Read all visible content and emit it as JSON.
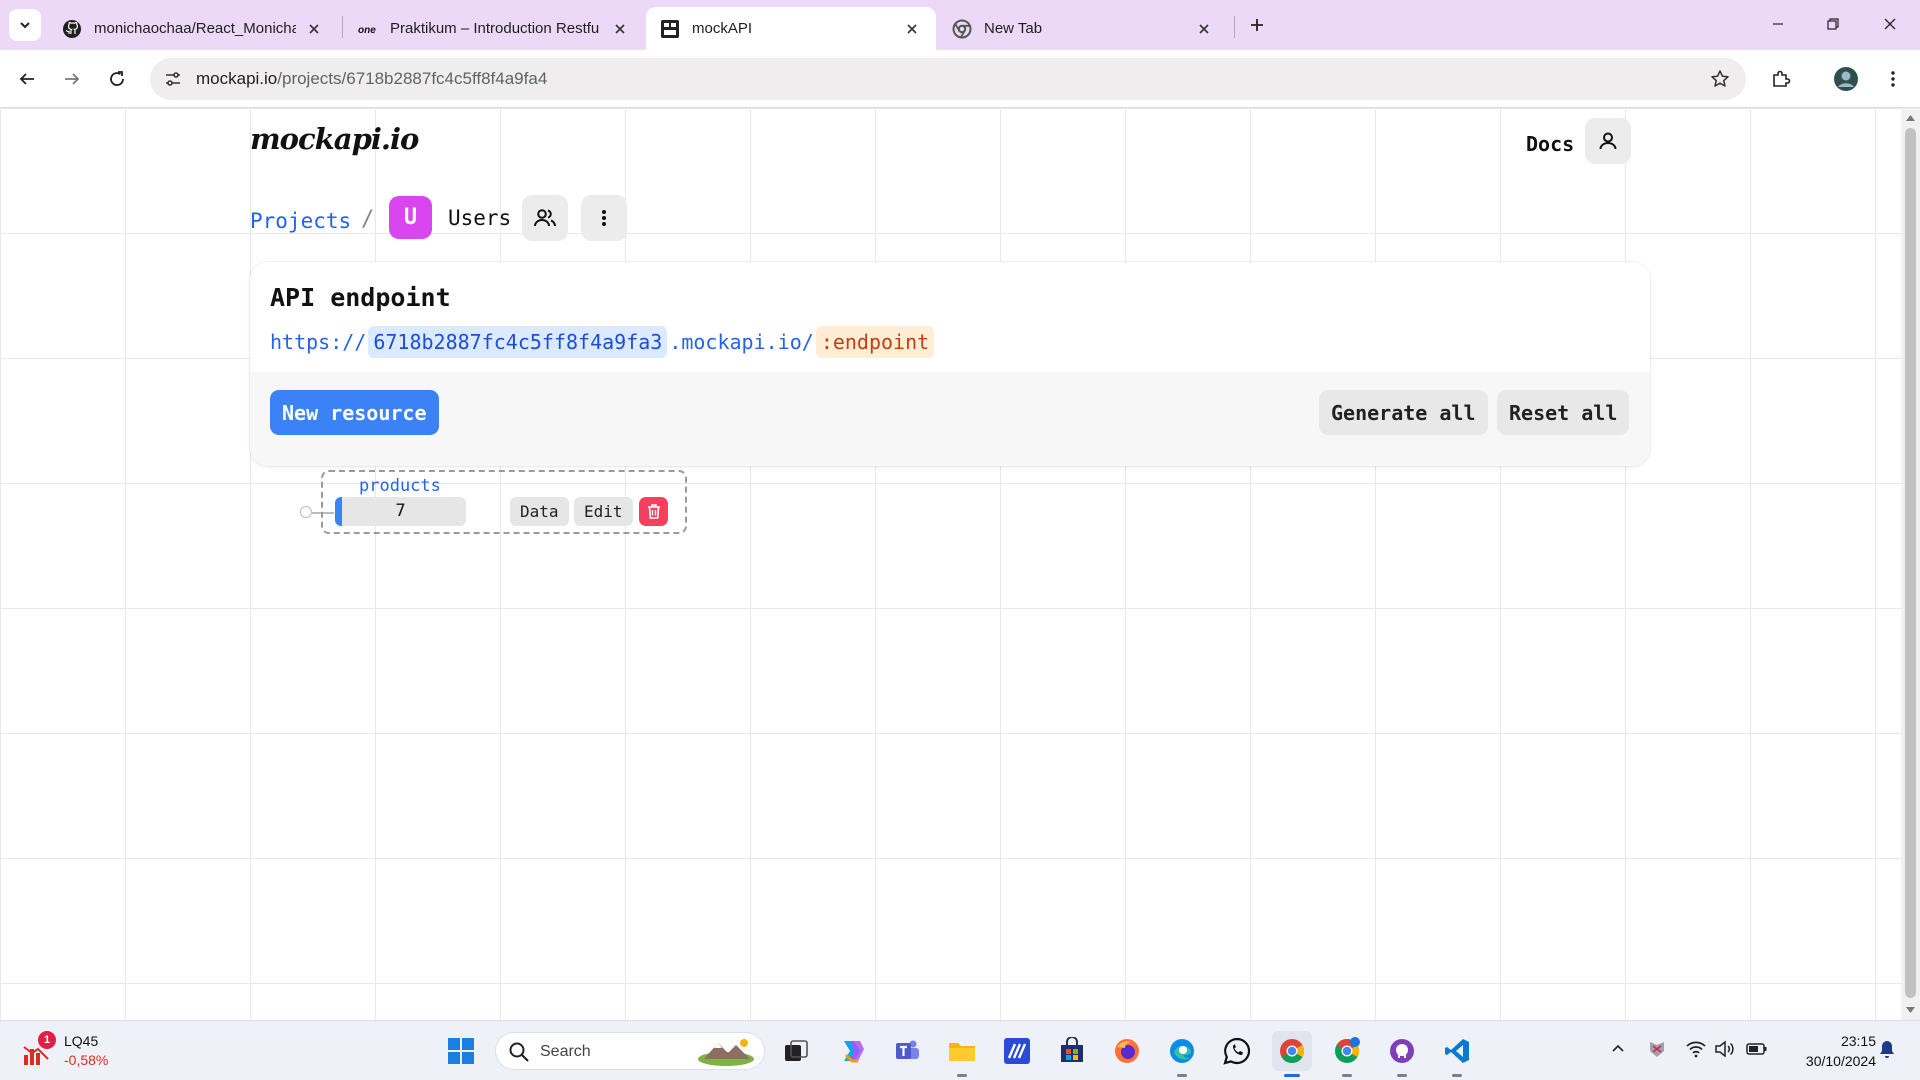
{
  "browser": {
    "tabs": [
      {
        "title": "monichaochaa/React_Monicha-",
        "favicon": "github-icon"
      },
      {
        "title": "Praktikum – Introduction Restfu",
        "favicon": "onenote-icon"
      },
      {
        "title": "mockAPI",
        "favicon": "mockapi-icon",
        "active": true
      },
      {
        "title": "New Tab",
        "favicon": "chrome-icon"
      }
    ],
    "url_domain": "mockapi.io",
    "url_path": "/projects/6718b2887fc4c5ff8f4a9fa4"
  },
  "page": {
    "logo": "mockapi.io",
    "docs_label": "Docs",
    "breadcrumb": {
      "projects_label": "Projects",
      "separator": "/",
      "project_initial": "U",
      "project_name": "Users"
    },
    "api_card": {
      "title": "API endpoint",
      "protocol": "https://",
      "project_id": "6718b2887fc4c5ff8f4a9fa3",
      "domain": ".mockapi.io/",
      "endpoint": ":endpoint",
      "new_resource_label": "New resource",
      "generate_all_label": "Generate all",
      "reset_all_label": "Reset all"
    },
    "resources": [
      {
        "name": "products",
        "count": "7",
        "data_label": "Data",
        "edit_label": "Edit"
      }
    ]
  },
  "taskbar": {
    "stock": {
      "badge": "1",
      "name": "LQ45",
      "change": "-0,58%"
    },
    "search_label": "Search",
    "clock": {
      "time": "23:15",
      "date": "30/10/2024"
    }
  },
  "colors": {
    "accent": "#3b82f6",
    "link": "#2463eb",
    "project_avatar": "#d946ef",
    "delete": "#f43f5e",
    "endpoint_highlight": "#c2410c"
  }
}
